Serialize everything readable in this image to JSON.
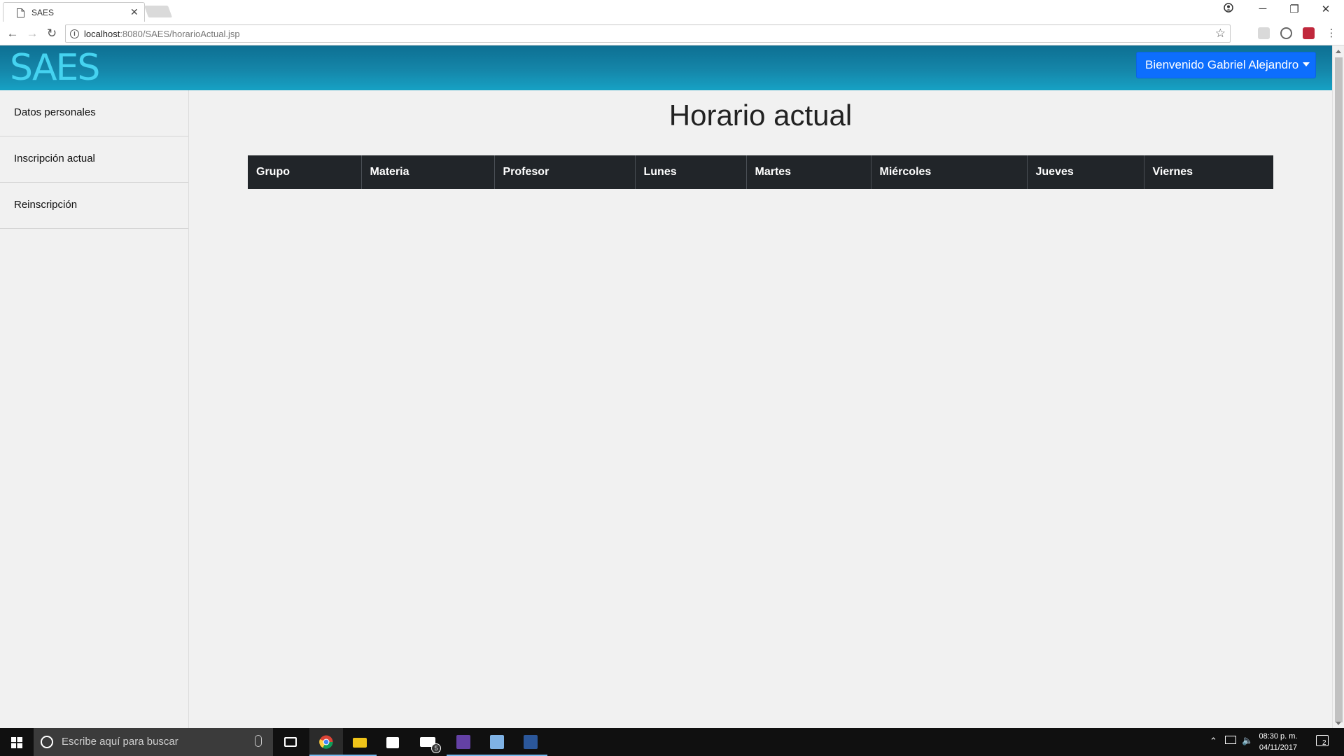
{
  "browser": {
    "tab_title": "SAES",
    "url_host": "localhost",
    "url_path": ":8080/SAES/horarioActual.jsp"
  },
  "header": {
    "logo_text": "SAES",
    "welcome_label": "Bienvenido Gabriel Alejandro"
  },
  "sidebar": {
    "items": [
      {
        "label": "Datos personales"
      },
      {
        "label": "Inscripción actual"
      },
      {
        "label": "Reinscripción"
      }
    ]
  },
  "main": {
    "title": "Horario actual",
    "table": {
      "columns": [
        "Grupo",
        "Materia",
        "Profesor",
        "Lunes",
        "Martes",
        "Miércoles",
        "Jueves",
        "Viernes"
      ],
      "rows": []
    }
  },
  "taskbar": {
    "search_placeholder": "Escribe aquí para buscar",
    "mail_badge": "5",
    "time": "08:30 p. m.",
    "date": "04/11/2017",
    "notifications_count": "2"
  },
  "colors": {
    "header_gradient_top": "#0d6f92",
    "header_gradient_bottom": "#16a1c4",
    "welcome_button": "#0d6efd",
    "table_header": "#212529",
    "logo": "#45d3f0"
  }
}
